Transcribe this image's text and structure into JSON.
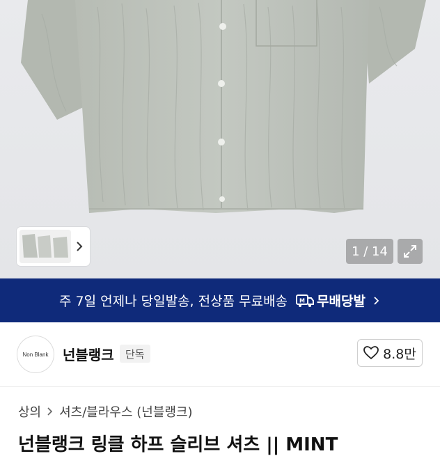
{
  "gallery": {
    "counter": "1 / 14"
  },
  "banner": {
    "text": "주 7일 언제나 당일발송, 전상품 무료배송",
    "brand_icon_letter": "M",
    "brand_label": "무배당발"
  },
  "store": {
    "logo_text": "Non Blank",
    "name": "넌블랭크",
    "badge": "단독",
    "like_count": "8.8만"
  },
  "breadcrumb": {
    "items": [
      "상의",
      "셔츠/블라우스 (넌블랭크)"
    ]
  },
  "product": {
    "title": "넌블랭크 링클 하프 슬리브 셔츠 || MINT"
  },
  "colors": {
    "banner_bg": "#0f2a7a",
    "shirt": "#b9beb7"
  }
}
